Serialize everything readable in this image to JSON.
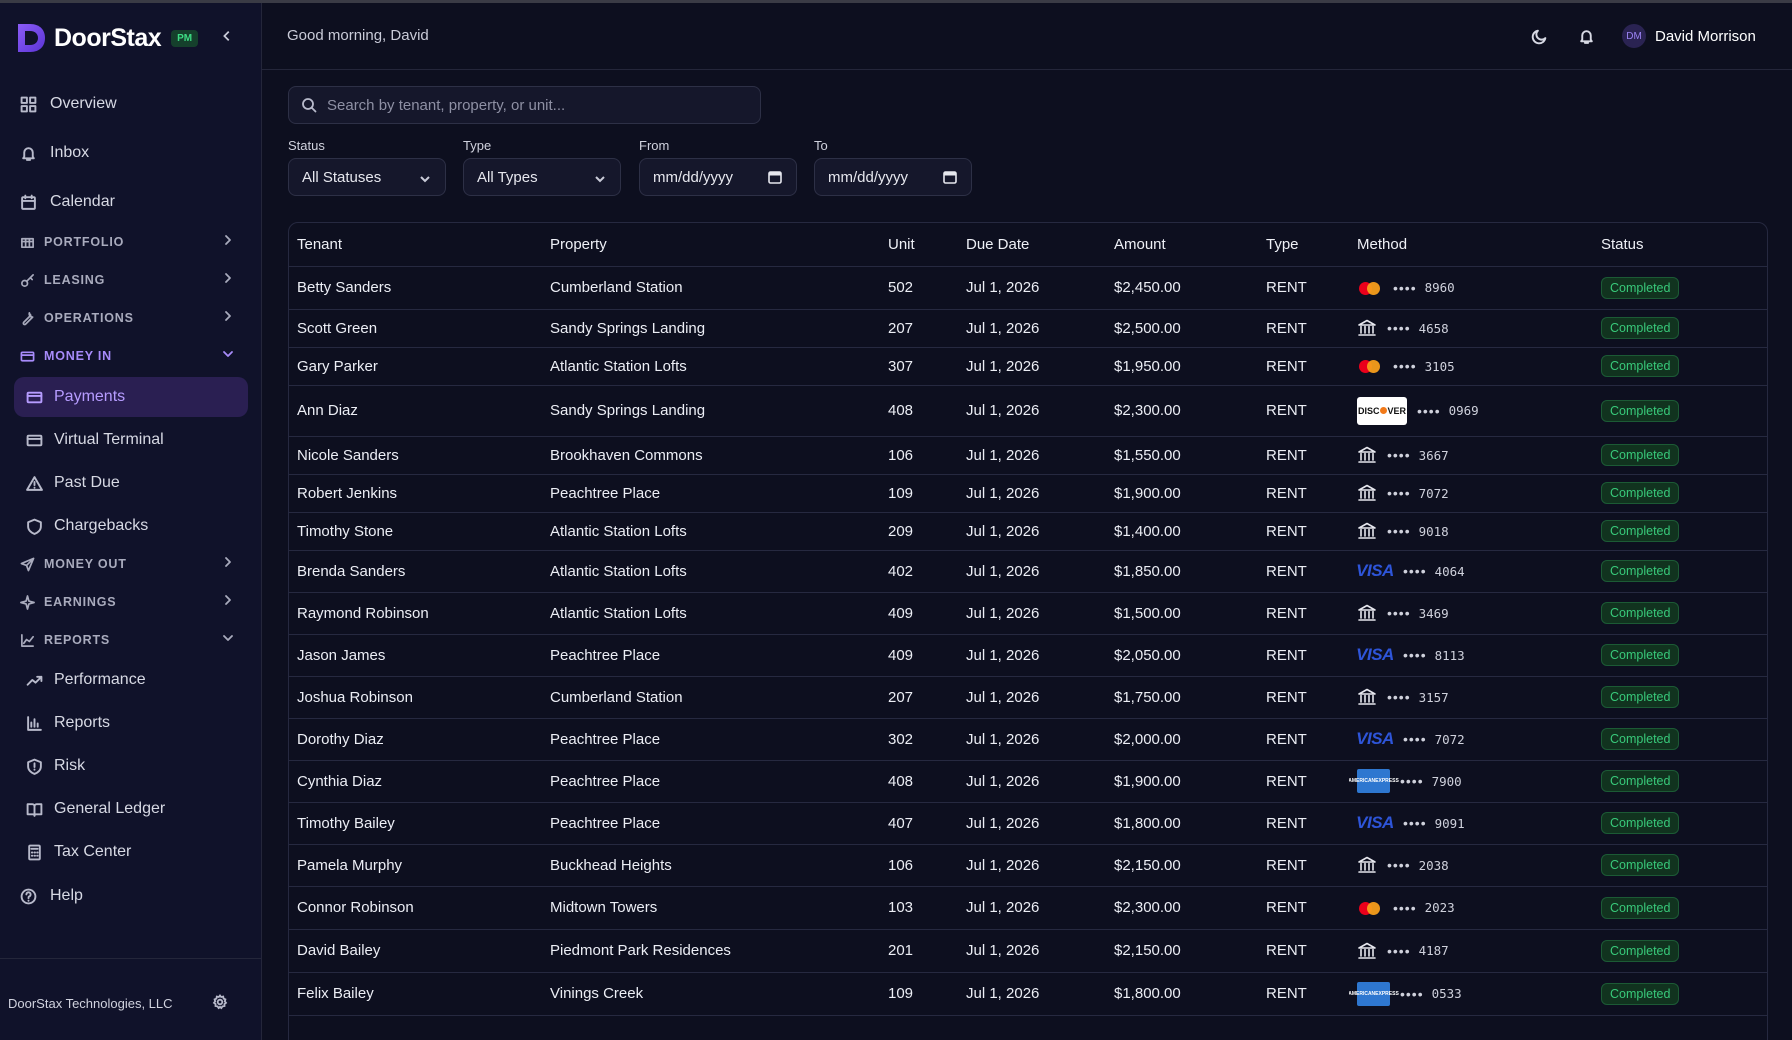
{
  "brand": {
    "name": "DoorStax",
    "badge": "PM"
  },
  "sidebar": {
    "top_items": [
      {
        "label": "Overview",
        "icon": "grid-icon"
      },
      {
        "label": "Inbox",
        "icon": "bell-icon"
      },
      {
        "label": "Calendar",
        "icon": "calendar-icon"
      }
    ],
    "sections": {
      "portfolio": "PORTFOLIO",
      "leasing": "LEASING",
      "operations": "OPERATIONS",
      "money_in": "MONEY IN",
      "money_out": "MONEY OUT",
      "earnings": "EARNINGS",
      "reports": "REPORTS"
    },
    "money_in_items": [
      {
        "label": "Payments",
        "icon": "card-icon",
        "active": true
      },
      {
        "label": "Virtual Terminal",
        "icon": "card-icon"
      },
      {
        "label": "Past Due",
        "icon": "warning-icon"
      },
      {
        "label": "Chargebacks",
        "icon": "shield-icon"
      }
    ],
    "reports_items": [
      {
        "label": "Performance",
        "icon": "trend-icon"
      },
      {
        "label": "Reports",
        "icon": "bar-chart-icon"
      },
      {
        "label": "Risk",
        "icon": "shield-alert-icon"
      },
      {
        "label": "General Ledger",
        "icon": "book-icon"
      },
      {
        "label": "Tax Center",
        "icon": "calculator-icon"
      }
    ],
    "help": "Help",
    "company": "DoorStax Technologies, LLC"
  },
  "header": {
    "greeting": "Good morning, David",
    "user_initials": "DM",
    "user_name": "David Morrison"
  },
  "filters": {
    "search_placeholder": "Search by tenant, property, or unit...",
    "status_label": "Status",
    "status_value": "All Statuses",
    "type_label": "Type",
    "type_value": "All Types",
    "from_label": "From",
    "from_placeholder": "mm/dd/yyyy",
    "to_label": "To",
    "to_placeholder": "mm/dd/yyyy"
  },
  "table": {
    "columns": [
      "Tenant",
      "Property",
      "Unit",
      "Due Date",
      "Amount",
      "Type",
      "Method",
      "Status"
    ],
    "rows": [
      {
        "tenant": "Betty Sanders",
        "property": "Cumberland Station",
        "unit": "502",
        "due": "Jul 1, 2026",
        "amount": "$2,450.00",
        "type": "RENT",
        "method": "mastercard",
        "dots": "••••",
        "last4": "8960",
        "status": "Completed"
      },
      {
        "tenant": "Scott Green",
        "property": "Sandy Springs Landing",
        "unit": "207",
        "due": "Jul 1, 2026",
        "amount": "$2,500.00",
        "type": "RENT",
        "method": "bank",
        "dots": "••••",
        "last4": "4658",
        "status": "Completed"
      },
      {
        "tenant": "Gary Parker",
        "property": "Atlantic Station Lofts",
        "unit": "307",
        "due": "Jul 1, 2026",
        "amount": "$1,950.00",
        "type": "RENT",
        "method": "mastercard",
        "dots": "••••",
        "last4": "3105",
        "status": "Completed"
      },
      {
        "tenant": "Ann Diaz",
        "property": "Sandy Springs Landing",
        "unit": "408",
        "due": "Jul 1, 2026",
        "amount": "$2,300.00",
        "type": "RENT",
        "method": "discover",
        "dots": "••••",
        "last4": "0969",
        "status": "Completed"
      },
      {
        "tenant": "Nicole Sanders",
        "property": "Brookhaven Commons",
        "unit": "106",
        "due": "Jul 1, 2026",
        "amount": "$1,550.00",
        "type": "RENT",
        "method": "bank",
        "dots": "••••",
        "last4": "3667",
        "status": "Completed"
      },
      {
        "tenant": "Robert Jenkins",
        "property": "Peachtree Place",
        "unit": "109",
        "due": "Jul 1, 2026",
        "amount": "$1,900.00",
        "type": "RENT",
        "method": "bank",
        "dots": "••••",
        "last4": "7072",
        "status": "Completed"
      },
      {
        "tenant": "Timothy Stone",
        "property": "Atlantic Station Lofts",
        "unit": "209",
        "due": "Jul 1, 2026",
        "amount": "$1,400.00",
        "type": "RENT",
        "method": "bank",
        "dots": "••••",
        "last4": "9018",
        "status": "Completed"
      },
      {
        "tenant": "Brenda Sanders",
        "property": "Atlantic Station Lofts",
        "unit": "402",
        "due": "Jul 1, 2026",
        "amount": "$1,850.00",
        "type": "RENT",
        "method": "visa",
        "dots": "••••",
        "last4": "4064",
        "status": "Completed"
      },
      {
        "tenant": "Raymond Robinson",
        "property": "Atlantic Station Lofts",
        "unit": "409",
        "due": "Jul 1, 2026",
        "amount": "$1,500.00",
        "type": "RENT",
        "method": "bank",
        "dots": "••••",
        "last4": "3469",
        "status": "Completed"
      },
      {
        "tenant": "Jason James",
        "property": "Peachtree Place",
        "unit": "409",
        "due": "Jul 1, 2026",
        "amount": "$2,050.00",
        "type": "RENT",
        "method": "visa",
        "dots": "••••",
        "last4": "8113",
        "status": "Completed"
      },
      {
        "tenant": "Joshua Robinson",
        "property": "Cumberland Station",
        "unit": "207",
        "due": "Jul 1, 2026",
        "amount": "$1,750.00",
        "type": "RENT",
        "method": "bank",
        "dots": "••••",
        "last4": "3157",
        "status": "Completed"
      },
      {
        "tenant": "Dorothy Diaz",
        "property": "Peachtree Place",
        "unit": "302",
        "due": "Jul 1, 2026",
        "amount": "$2,000.00",
        "type": "RENT",
        "method": "visa",
        "dots": "••••",
        "last4": "7072",
        "status": "Completed"
      },
      {
        "tenant": "Cynthia Diaz",
        "property": "Peachtree Place",
        "unit": "408",
        "due": "Jul 1, 2026",
        "amount": "$1,900.00",
        "type": "RENT",
        "method": "amex",
        "dots": "••••",
        "last4": "7900",
        "status": "Completed"
      },
      {
        "tenant": "Timothy Bailey",
        "property": "Peachtree Place",
        "unit": "407",
        "due": "Jul 1, 2026",
        "amount": "$1,800.00",
        "type": "RENT",
        "method": "visa",
        "dots": "••••",
        "last4": "9091",
        "status": "Completed"
      },
      {
        "tenant": "Pamela Murphy",
        "property": "Buckhead Heights",
        "unit": "106",
        "due": "Jul 1, 2026",
        "amount": "$2,150.00",
        "type": "RENT",
        "method": "bank",
        "dots": "••••",
        "last4": "2038",
        "status": "Completed"
      },
      {
        "tenant": "Connor Robinson",
        "property": "Midtown Towers",
        "unit": "103",
        "due": "Jul 1, 2026",
        "amount": "$2,300.00",
        "type": "RENT",
        "method": "mastercard",
        "dots": "••••",
        "last4": "2023",
        "status": "Completed"
      },
      {
        "tenant": "David Bailey",
        "property": "Piedmont Park Residences",
        "unit": "201",
        "due": "Jul 1, 2026",
        "amount": "$2,150.00",
        "type": "RENT",
        "method": "bank",
        "dots": "••••",
        "last4": "4187",
        "status": "Completed"
      },
      {
        "tenant": "Felix Bailey",
        "property": "Vinings Creek",
        "unit": "109",
        "due": "Jul 1, 2026",
        "amount": "$1,800.00",
        "type": "RENT",
        "method": "amex",
        "dots": "••••",
        "last4": "0533",
        "status": "Completed"
      }
    ]
  },
  "brand_labels": {
    "visa": "VISA",
    "discover": "DISC",
    "discover_tail": "VER",
    "amex_line1": "AMERICAN",
    "amex_line2": "EXPRESS"
  },
  "colors": {
    "accent": "#a78bfa",
    "success": "#38c97a",
    "background": "#0d0f1f"
  }
}
